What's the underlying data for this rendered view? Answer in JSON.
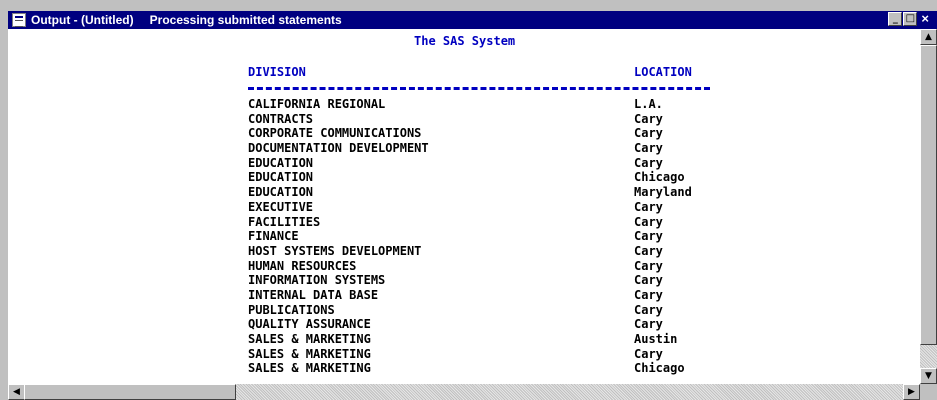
{
  "window": {
    "title": "Output - (Untitled)",
    "status": "Processing submitted statements",
    "controls": {
      "minimize": "_",
      "maximize": "□",
      "close": "×"
    }
  },
  "report": {
    "title": "The SAS System",
    "columns": {
      "division": "DIVISION",
      "location": "LOCATION"
    },
    "rows": [
      {
        "division": "CALIFORNIA REGIONAL",
        "location": "L.A."
      },
      {
        "division": "CONTRACTS",
        "location": "Cary"
      },
      {
        "division": "CORPORATE COMMUNICATIONS",
        "location": "Cary"
      },
      {
        "division": "DOCUMENTATION DEVELOPMENT",
        "location": "Cary"
      },
      {
        "division": "EDUCATION",
        "location": "Cary"
      },
      {
        "division": "EDUCATION",
        "location": "Chicago"
      },
      {
        "division": "EDUCATION",
        "location": "Maryland"
      },
      {
        "division": "EXECUTIVE",
        "location": "Cary"
      },
      {
        "division": "FACILITIES",
        "location": "Cary"
      },
      {
        "division": "FINANCE",
        "location": "Cary"
      },
      {
        "division": "HOST SYSTEMS DEVELOPMENT",
        "location": "Cary"
      },
      {
        "division": "HUMAN RESOURCES",
        "location": "Cary"
      },
      {
        "division": "INFORMATION SYSTEMS",
        "location": "Cary"
      },
      {
        "division": "INTERNAL DATA BASE",
        "location": "Cary"
      },
      {
        "division": "PUBLICATIONS",
        "location": "Cary"
      },
      {
        "division": "QUALITY ASSURANCE",
        "location": "Cary"
      },
      {
        "division": "SALES & MARKETING",
        "location": "Austin"
      },
      {
        "division": "SALES & MARKETING",
        "location": "Cary"
      },
      {
        "division": "SALES & MARKETING",
        "location": "Chicago"
      }
    ]
  },
  "scroll": {
    "up": "▲",
    "down": "▼",
    "left": "◀",
    "right": "▶"
  },
  "colors": {
    "titlebar": "#000080",
    "heading": "#0000c0",
    "chrome": "#c0c0c0"
  }
}
